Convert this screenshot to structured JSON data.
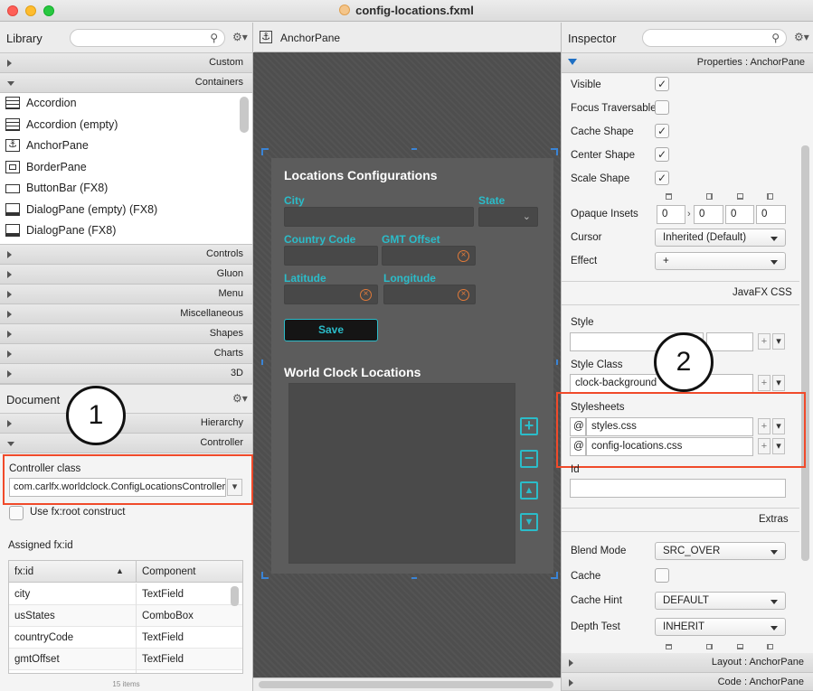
{
  "window": {
    "title": "config-locations.fxml"
  },
  "library": {
    "title": "Library",
    "sections_top": [
      "Custom",
      "Containers"
    ],
    "items": [
      "Accordion",
      "Accordion  (empty)",
      "AnchorPane",
      "BorderPane",
      "ButtonBar  (FX8)",
      "DialogPane (empty)  (FX8)",
      "DialogPane  (FX8)"
    ],
    "sections_bottom": [
      "Controls",
      "Gluon",
      "Menu",
      "Miscellaneous",
      "Shapes",
      "Charts",
      "3D"
    ]
  },
  "document": {
    "title": "Document",
    "sections": [
      "Hierarchy",
      "Controller"
    ],
    "controller_class_label": "Controller class",
    "controller_class_value": "com.carlfx.worldclock.ConfigLocationsController",
    "fxroot_label": "Use fx:root construct",
    "assigned_label": "Assigned fx:id",
    "table": {
      "headers": [
        "fx:id",
        "Component"
      ],
      "rows": [
        [
          "city",
          "TextField"
        ],
        [
          "usStates",
          "ComboBox"
        ],
        [
          "countryCode",
          "TextField"
        ],
        [
          "gmtOffset",
          "TextField"
        ]
      ]
    },
    "items_count": "15 items"
  },
  "canvas": {
    "breadcrumb": "AnchorPane",
    "form_title": "Locations Configurations",
    "labels": {
      "city": "City",
      "state": "State",
      "country_code": "Country Code",
      "gmt_offset": "GMT Offset",
      "latitude": "Latitude",
      "longitude": "Longitude"
    },
    "save_label": "Save",
    "clock_title": "World Clock Locations",
    "buttons": [
      "+",
      "−",
      "▲",
      "▼"
    ]
  },
  "inspector": {
    "title": "Inspector",
    "properties_header": "Properties : AnchorPane",
    "checkboxes": [
      {
        "label": "Visible",
        "checked": true
      },
      {
        "label": "Focus Traversable",
        "checked": false
      },
      {
        "label": "Cache Shape",
        "checked": true
      },
      {
        "label": "Center Shape",
        "checked": true
      },
      {
        "label": "Scale Shape",
        "checked": true
      }
    ],
    "opaque_insets_label": "Opaque Insets",
    "opaque_insets": [
      "0",
      "0",
      "0",
      "0"
    ],
    "cursor_label": "Cursor",
    "cursor_value": "Inherited (Default)",
    "effect_label": "Effect",
    "effect_value": "+",
    "javafx_css": "JavaFX CSS",
    "style_label": "Style",
    "style_class_label": "Style Class",
    "style_class_value": "clock-background",
    "stylesheets_label": "Stylesheets",
    "stylesheets": [
      "styles.css",
      "config-locations.css"
    ],
    "at": "@",
    "id_label": "Id",
    "extras": "Extras",
    "blend_mode_label": "Blend Mode",
    "blend_mode_value": "SRC_OVER",
    "cache_label": "Cache",
    "cache_hint_label": "Cache Hint",
    "cache_hint_value": "DEFAULT",
    "depth_test_label": "Depth Test",
    "depth_test_value": "INHERIT",
    "layout_header": "Layout : AnchorPane",
    "code_header": "Code : AnchorPane"
  },
  "annotations": {
    "one": "1",
    "two": "2"
  }
}
